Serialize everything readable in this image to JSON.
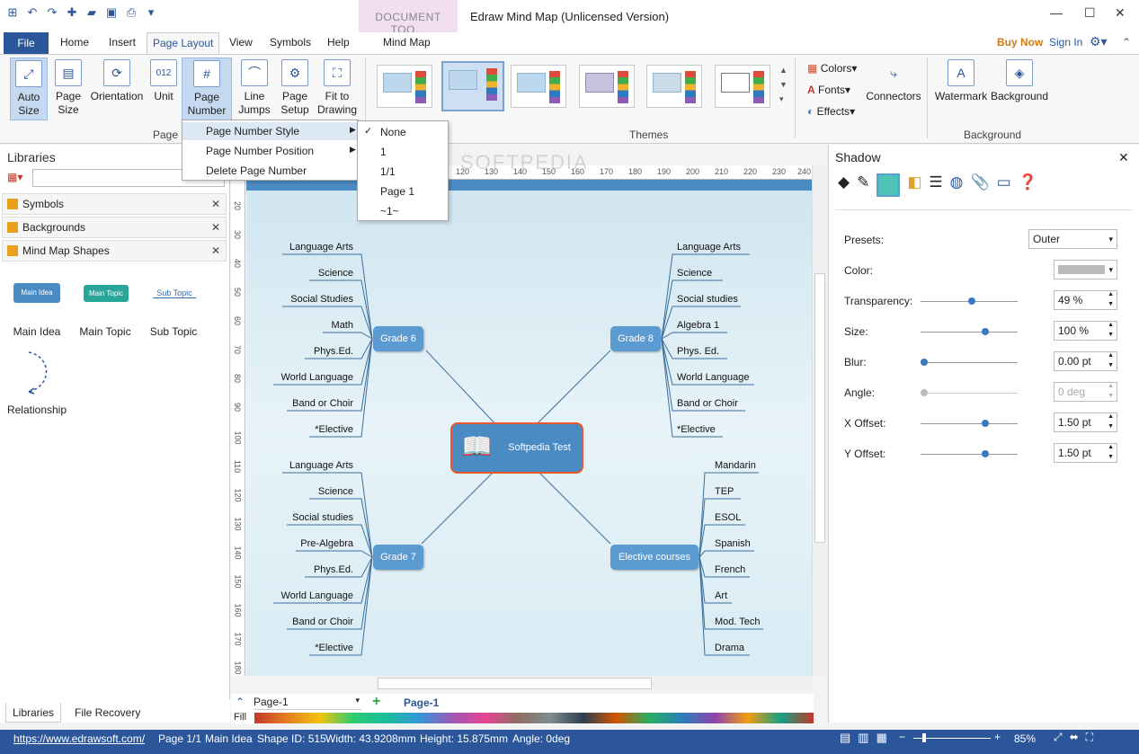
{
  "app": {
    "title": "Edraw Mind Map (Unlicensed Version)",
    "context_tab_header": "DOCUMENT TOO...",
    "buy_now": "Buy Now",
    "sign_in": "Sign In"
  },
  "tabs": {
    "file": "File",
    "home": "Home",
    "insert": "Insert",
    "page_layout": "Page Layout",
    "view": "View",
    "symbols": "Symbols",
    "help": "Help",
    "mind_map": "Mind Map"
  },
  "ribbon": {
    "auto_size": "Auto Size",
    "page_size": "Page Size",
    "orientation": "Orientation",
    "unit": "Unit",
    "page_number": "Page Number",
    "line_jumps": "Line Jumps",
    "page_setup": "Page Setup",
    "fit_to_drawing": "Fit to Drawing",
    "group_page": "Page S",
    "group_themes": "Themes",
    "group_background": "Background",
    "colors": "Colors",
    "fonts": "Fonts",
    "effects": "Effects",
    "connectors": "Connectors",
    "watermark": "Watermark",
    "background": "Background",
    "unit_icon": "012"
  },
  "menu": {
    "items": [
      "Page Number Style",
      "Page Number Position",
      "Delete Page Number"
    ],
    "submenu": [
      "None",
      "1",
      "1/1",
      "Page 1",
      "~1~"
    ],
    "checked": "None"
  },
  "libraries": {
    "title": "Libraries",
    "items": [
      "Symbols",
      "Backgrounds",
      "Mind Map Shapes"
    ],
    "shape_previews": [
      "Main Idea",
      "Main Topic",
      "Sub Topic"
    ],
    "shapes": [
      "Main Idea",
      "Main Topic",
      "Sub Topic",
      "Relationship"
    ]
  },
  "ruler": {
    "top": [
      "120",
      "130",
      "140",
      "150",
      "160",
      "170",
      "180",
      "190",
      "200",
      "210",
      "220",
      "230",
      "240"
    ],
    "left": [
      "20",
      "30",
      "40",
      "50",
      "60",
      "70",
      "80",
      "90",
      "100",
      "110",
      "120",
      "130",
      "140",
      "150",
      "160",
      "170",
      "180"
    ]
  },
  "mindmap": {
    "center": "Softpedia Test",
    "watermark": "SOFTPEDIA",
    "grade6": {
      "label": "Grade 6",
      "subs": [
        "Language Arts",
        "Science",
        "Social Studies",
        "Math",
        "Phys.Ed.",
        "World Language",
        "Band or Choir",
        "*Elective"
      ]
    },
    "grade8": {
      "label": "Grade 8",
      "subs": [
        "Language Arts",
        "Science",
        "Social studies",
        "Algebra 1",
        "Phys. Ed.",
        "World Language",
        "Band or Choir",
        "*Elective"
      ]
    },
    "grade7": {
      "label": "Grade 7",
      "subs": [
        "Language Arts",
        "Science",
        "Social studies",
        "Pre-Algebra",
        "Phys.Ed.",
        "World Language",
        "Band or Choir",
        "*Elective"
      ]
    },
    "elective": {
      "label": "Elective courses",
      "subs": [
        "Mandarin",
        "TEP",
        "ESOL",
        "Spanish",
        "French",
        "Art",
        "Mod. Tech",
        "Drama"
      ]
    }
  },
  "shadow": {
    "title": "Shadow",
    "presets_label": "Presets:",
    "presets": "Outer",
    "color_label": "Color:",
    "transparency_label": "Transparency:",
    "transparency": "49 %",
    "transparency_value": 0.49,
    "size_label": "Size:",
    "size": "100 %",
    "size_value": 0.63,
    "blur_label": "Blur:",
    "blur": "0.00 pt",
    "blur_value": 0.0,
    "angle_label": "Angle:",
    "angle": "0 deg",
    "angle_value": 0.0,
    "xoffset_label": "X Offset:",
    "xoffset": "1.50 pt",
    "xoffset_value": 0.63,
    "yoffset_label": "Y Offset:",
    "yoffset": "1.50 pt",
    "yoffset_value": 0.63
  },
  "pages": {
    "current": "Page-1",
    "tab": "Page-1",
    "fill_label": "Fill"
  },
  "bottom_tabs": [
    "Libraries",
    "File Recovery"
  ],
  "status": {
    "url": "https://www.edrawsoft.com/",
    "page": "Page 1/1",
    "selection": "Main Idea",
    "shape_id": "Shape ID: 515",
    "width": "Width: 43.9208mm",
    "height": "Height: 15.875mm",
    "angle": "Angle: 0deg",
    "zoom": "85%"
  }
}
